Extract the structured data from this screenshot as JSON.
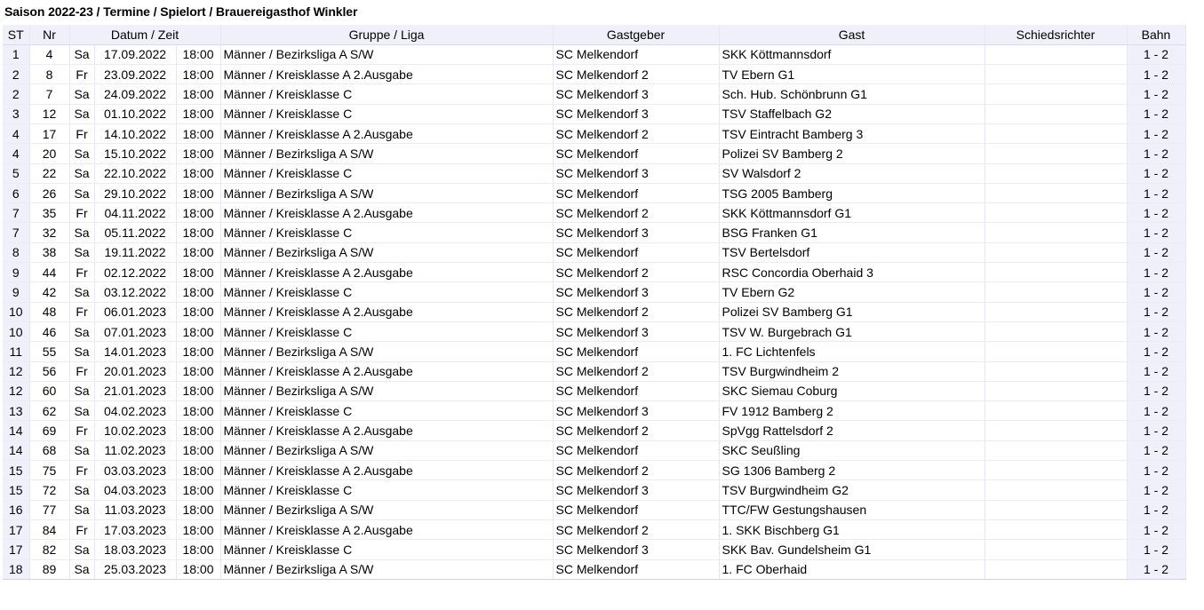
{
  "page": {
    "title": "Saison 2022-23 / Termine / Spielort / Brauereigasthof Winkler"
  },
  "table": {
    "headers": [
      "ST",
      "Nr",
      "Datum / Zeit",
      "Gruppe / Liga",
      "Gastgeber",
      "Gast",
      "Schiedsrichter",
      "Bahn"
    ],
    "rows": [
      {
        "st": "1",
        "nr": "4",
        "tag": "Sa",
        "datum": "17.09.2022",
        "zeit": "18:00",
        "liga": "Männer / Bezirksliga A S/W",
        "gastgeber": "SC Melkendorf",
        "gast": "SKK Köttmannsdorf",
        "schiri": "",
        "bahn": "1 - 2",
        "sep": true
      },
      {
        "st": "2",
        "nr": "8",
        "tag": "Fr",
        "datum": "23.09.2022",
        "zeit": "18:00",
        "liga": "Männer / Kreisklasse A 2.Ausgabe",
        "gastgeber": "SC Melkendorf 2",
        "gast": "TV Ebern G1",
        "schiri": "",
        "bahn": "1 - 2",
        "sep": true
      },
      {
        "st": "2",
        "nr": "7",
        "tag": "Sa",
        "datum": "24.09.2022",
        "zeit": "18:00",
        "liga": "Männer / Kreisklasse C",
        "gastgeber": "SC Melkendorf 3",
        "gast": "Sch. Hub. Schönbrunn G1",
        "schiri": "",
        "bahn": "1 - 2",
        "sep": false
      },
      {
        "st": "3",
        "nr": "12",
        "tag": "Sa",
        "datum": "01.10.2022",
        "zeit": "18:00",
        "liga": "Männer / Kreisklasse C",
        "gastgeber": "SC Melkendorf 3",
        "gast": "TSV Staffelbach G2",
        "schiri": "",
        "bahn": "1 - 2",
        "sep": false
      },
      {
        "st": "4",
        "nr": "17",
        "tag": "Fr",
        "datum": "14.10.2022",
        "zeit": "18:00",
        "liga": "Männer / Kreisklasse A 2.Ausgabe",
        "gastgeber": "SC Melkendorf 2",
        "gast": "TSV Eintracht Bamberg 3",
        "schiri": "",
        "bahn": "1 - 2",
        "sep": true
      },
      {
        "st": "4",
        "nr": "20",
        "tag": "Sa",
        "datum": "15.10.2022",
        "zeit": "18:00",
        "liga": "Männer / Bezirksliga A S/W",
        "gastgeber": "SC Melkendorf",
        "gast": "Polizei SV Bamberg 2",
        "schiri": "",
        "bahn": "1 - 2",
        "sep": false
      },
      {
        "st": "5",
        "nr": "22",
        "tag": "Sa",
        "datum": "22.10.2022",
        "zeit": "18:00",
        "liga": "Männer / Kreisklasse C",
        "gastgeber": "SC Melkendorf 3",
        "gast": "SV Walsdorf 2",
        "schiri": "",
        "bahn": "1 - 2",
        "sep": false
      },
      {
        "st": "6",
        "nr": "26",
        "tag": "Sa",
        "datum": "29.10.2022",
        "zeit": "18:00",
        "liga": "Männer / Bezirksliga A S/W",
        "gastgeber": "SC Melkendorf",
        "gast": "TSG 2005 Bamberg",
        "schiri": "",
        "bahn": "1 - 2",
        "sep": true
      },
      {
        "st": "7",
        "nr": "35",
        "tag": "Fr",
        "datum": "04.11.2022",
        "zeit": "18:00",
        "liga": "Männer / Kreisklasse A 2.Ausgabe",
        "gastgeber": "SC Melkendorf 2",
        "gast": "SKK Köttmannsdorf G1",
        "schiri": "",
        "bahn": "1 - 2",
        "sep": false
      },
      {
        "st": "7",
        "nr": "32",
        "tag": "Sa",
        "datum": "05.11.2022",
        "zeit": "18:00",
        "liga": "Männer / Kreisklasse C",
        "gastgeber": "SC Melkendorf 3",
        "gast": "BSG Franken G1",
        "schiri": "",
        "bahn": "1 - 2",
        "sep": true
      },
      {
        "st": "8",
        "nr": "38",
        "tag": "Sa",
        "datum": "19.11.2022",
        "zeit": "18:00",
        "liga": "Männer / Bezirksliga A S/W",
        "gastgeber": "SC Melkendorf",
        "gast": "TSV Bertelsdorf",
        "schiri": "",
        "bahn": "1 - 2",
        "sep": false
      },
      {
        "st": "9",
        "nr": "44",
        "tag": "Fr",
        "datum": "02.12.2022",
        "zeit": "18:00",
        "liga": "Männer / Kreisklasse A 2.Ausgabe",
        "gastgeber": "SC Melkendorf 2",
        "gast": "RSC Concordia Oberhaid 3",
        "schiri": "",
        "bahn": "1 - 2",
        "sep": false
      },
      {
        "st": "9",
        "nr": "42",
        "tag": "Sa",
        "datum": "03.12.2022",
        "zeit": "18:00",
        "liga": "Männer / Kreisklasse C",
        "gastgeber": "SC Melkendorf 3",
        "gast": "TV Ebern G2",
        "schiri": "",
        "bahn": "1 - 2",
        "sep": true
      },
      {
        "st": "10",
        "nr": "48",
        "tag": "Fr",
        "datum": "06.01.2023",
        "zeit": "18:00",
        "liga": "Männer / Kreisklasse A 2.Ausgabe",
        "gastgeber": "SC Melkendorf 2",
        "gast": "Polizei SV Bamberg G1",
        "schiri": "",
        "bahn": "1 - 2",
        "sep": false
      },
      {
        "st": "10",
        "nr": "46",
        "tag": "Sa",
        "datum": "07.01.2023",
        "zeit": "18:00",
        "liga": "Männer / Kreisklasse C",
        "gastgeber": "SC Melkendorf 3",
        "gast": "TSV W. Burgebrach G1",
        "schiri": "",
        "bahn": "1 - 2",
        "sep": false
      },
      {
        "st": "11",
        "nr": "55",
        "tag": "Sa",
        "datum": "14.01.2023",
        "zeit": "18:00",
        "liga": "Männer / Bezirksliga A S/W",
        "gastgeber": "SC Melkendorf",
        "gast": "1. FC Lichtenfels",
        "schiri": "",
        "bahn": "1 - 2",
        "sep": true
      },
      {
        "st": "12",
        "nr": "56",
        "tag": "Fr",
        "datum": "20.01.2023",
        "zeit": "18:00",
        "liga": "Männer / Kreisklasse A 2.Ausgabe",
        "gastgeber": "SC Melkendorf 2",
        "gast": "TSV Burgwindheim 2",
        "schiri": "",
        "bahn": "1 - 2",
        "sep": false
      },
      {
        "st": "12",
        "nr": "60",
        "tag": "Sa",
        "datum": "21.01.2023",
        "zeit": "18:00",
        "liga": "Männer / Bezirksliga A S/W",
        "gastgeber": "SC Melkendorf",
        "gast": "SKC Siemau Coburg",
        "schiri": "",
        "bahn": "1 - 2",
        "sep": true
      },
      {
        "st": "13",
        "nr": "62",
        "tag": "Sa",
        "datum": "04.02.2023",
        "zeit": "18:00",
        "liga": "Männer / Kreisklasse C",
        "gastgeber": "SC Melkendorf 3",
        "gast": "FV 1912 Bamberg 2",
        "schiri": "",
        "bahn": "1 - 2",
        "sep": false
      },
      {
        "st": "14",
        "nr": "69",
        "tag": "Fr",
        "datum": "10.02.2023",
        "zeit": "18:00",
        "liga": "Männer / Kreisklasse A 2.Ausgabe",
        "gastgeber": "SC Melkendorf 2",
        "gast": "SpVgg Rattelsdorf 2",
        "schiri": "",
        "bahn": "1 - 2",
        "sep": false
      },
      {
        "st": "14",
        "nr": "68",
        "tag": "Sa",
        "datum": "11.02.2023",
        "zeit": "18:00",
        "liga": "Männer / Bezirksliga A S/W",
        "gastgeber": "SC Melkendorf",
        "gast": "SKC Seußling",
        "schiri": "",
        "bahn": "1 - 2",
        "sep": true
      },
      {
        "st": "15",
        "nr": "75",
        "tag": "Fr",
        "datum": "03.03.2023",
        "zeit": "18:00",
        "liga": "Männer / Kreisklasse A 2.Ausgabe",
        "gastgeber": "SC Melkendorf 2",
        "gast": "SG 1306 Bamberg 2",
        "schiri": "",
        "bahn": "1 - 2",
        "sep": false
      },
      {
        "st": "15",
        "nr": "72",
        "tag": "Sa",
        "datum": "04.03.2023",
        "zeit": "18:00",
        "liga": "Männer / Kreisklasse C",
        "gastgeber": "SC Melkendorf 3",
        "gast": "TSV Burgwindheim G2",
        "schiri": "",
        "bahn": "1 - 2",
        "sep": false
      },
      {
        "st": "16",
        "nr": "77",
        "tag": "Sa",
        "datum": "11.03.2023",
        "zeit": "18:00",
        "liga": "Männer / Bezirksliga A S/W",
        "gastgeber": "SC Melkendorf",
        "gast": "TTC/FW Gestungshausen",
        "schiri": "",
        "bahn": "1 - 2",
        "sep": true
      },
      {
        "st": "17",
        "nr": "84",
        "tag": "Fr",
        "datum": "17.03.2023",
        "zeit": "18:00",
        "liga": "Männer / Kreisklasse A 2.Ausgabe",
        "gastgeber": "SC Melkendorf 2",
        "gast": "1. SKK Bischberg G1",
        "schiri": "",
        "bahn": "1 - 2",
        "sep": false
      },
      {
        "st": "17",
        "nr": "82",
        "tag": "Sa",
        "datum": "18.03.2023",
        "zeit": "18:00",
        "liga": "Männer / Kreisklasse C",
        "gastgeber": "SC Melkendorf 3",
        "gast": "SKK Bav. Gundelsheim G1",
        "schiri": "",
        "bahn": "1 - 2",
        "sep": true
      },
      {
        "st": "18",
        "nr": "89",
        "tag": "Sa",
        "datum": "25.03.2023",
        "zeit": "18:00",
        "liga": "Männer / Bezirksliga A S/W",
        "gastgeber": "SC Melkendorf",
        "gast": "1. FC Oberhaid",
        "schiri": "",
        "bahn": "1 - 2",
        "sep": false
      }
    ]
  }
}
